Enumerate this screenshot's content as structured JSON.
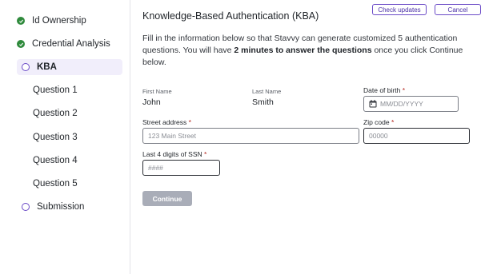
{
  "sidebar": {
    "items": [
      {
        "label": "Id Ownership",
        "state": "done"
      },
      {
        "label": "Credential Analysis",
        "state": "done"
      },
      {
        "label": "KBA",
        "state": "active"
      },
      {
        "label": "Question 1",
        "state": "sub"
      },
      {
        "label": "Question 2",
        "state": "sub"
      },
      {
        "label": "Question 3",
        "state": "sub"
      },
      {
        "label": "Question 4",
        "state": "sub"
      },
      {
        "label": "Question 5",
        "state": "sub"
      },
      {
        "label": "Submission",
        "state": "pending"
      }
    ]
  },
  "header": {
    "check_updates_label": "Check updates",
    "cancel_label": "Cancel"
  },
  "main": {
    "title": "Knowledge-Based Authentication (KBA)",
    "intro_part1": "Fill in the information below so that Stavvy can generate customized 5 authentication questions. You will have ",
    "intro_bold": "2 minutes to answer the questions",
    "intro_part2": " once you click Continue below."
  },
  "form": {
    "first_name_label": "First Name",
    "first_name_value": "John",
    "last_name_label": "Last Name",
    "last_name_value": "Smith",
    "dob_label": "Date of birth",
    "dob_placeholder": "MM/DD/YYYY",
    "street_label": "Street address",
    "street_placeholder": "123 Main Street",
    "zip_label": "Zip code",
    "zip_placeholder": "00000",
    "ssn_label": "Last 4 digits of SSN",
    "ssn_placeholder": "####",
    "required_mark": "*",
    "continue_label": "Continue"
  },
  "colors": {
    "accent": "#6b4bc7",
    "done_green": "#2f8a3c",
    "active_bg": "#f1eefb",
    "required_red": "#b3261e",
    "disabled_button": "#a9adb8"
  },
  "icons": {
    "done": "check-circle-icon",
    "pending": "ring-icon",
    "calendar": "calendar-icon"
  }
}
